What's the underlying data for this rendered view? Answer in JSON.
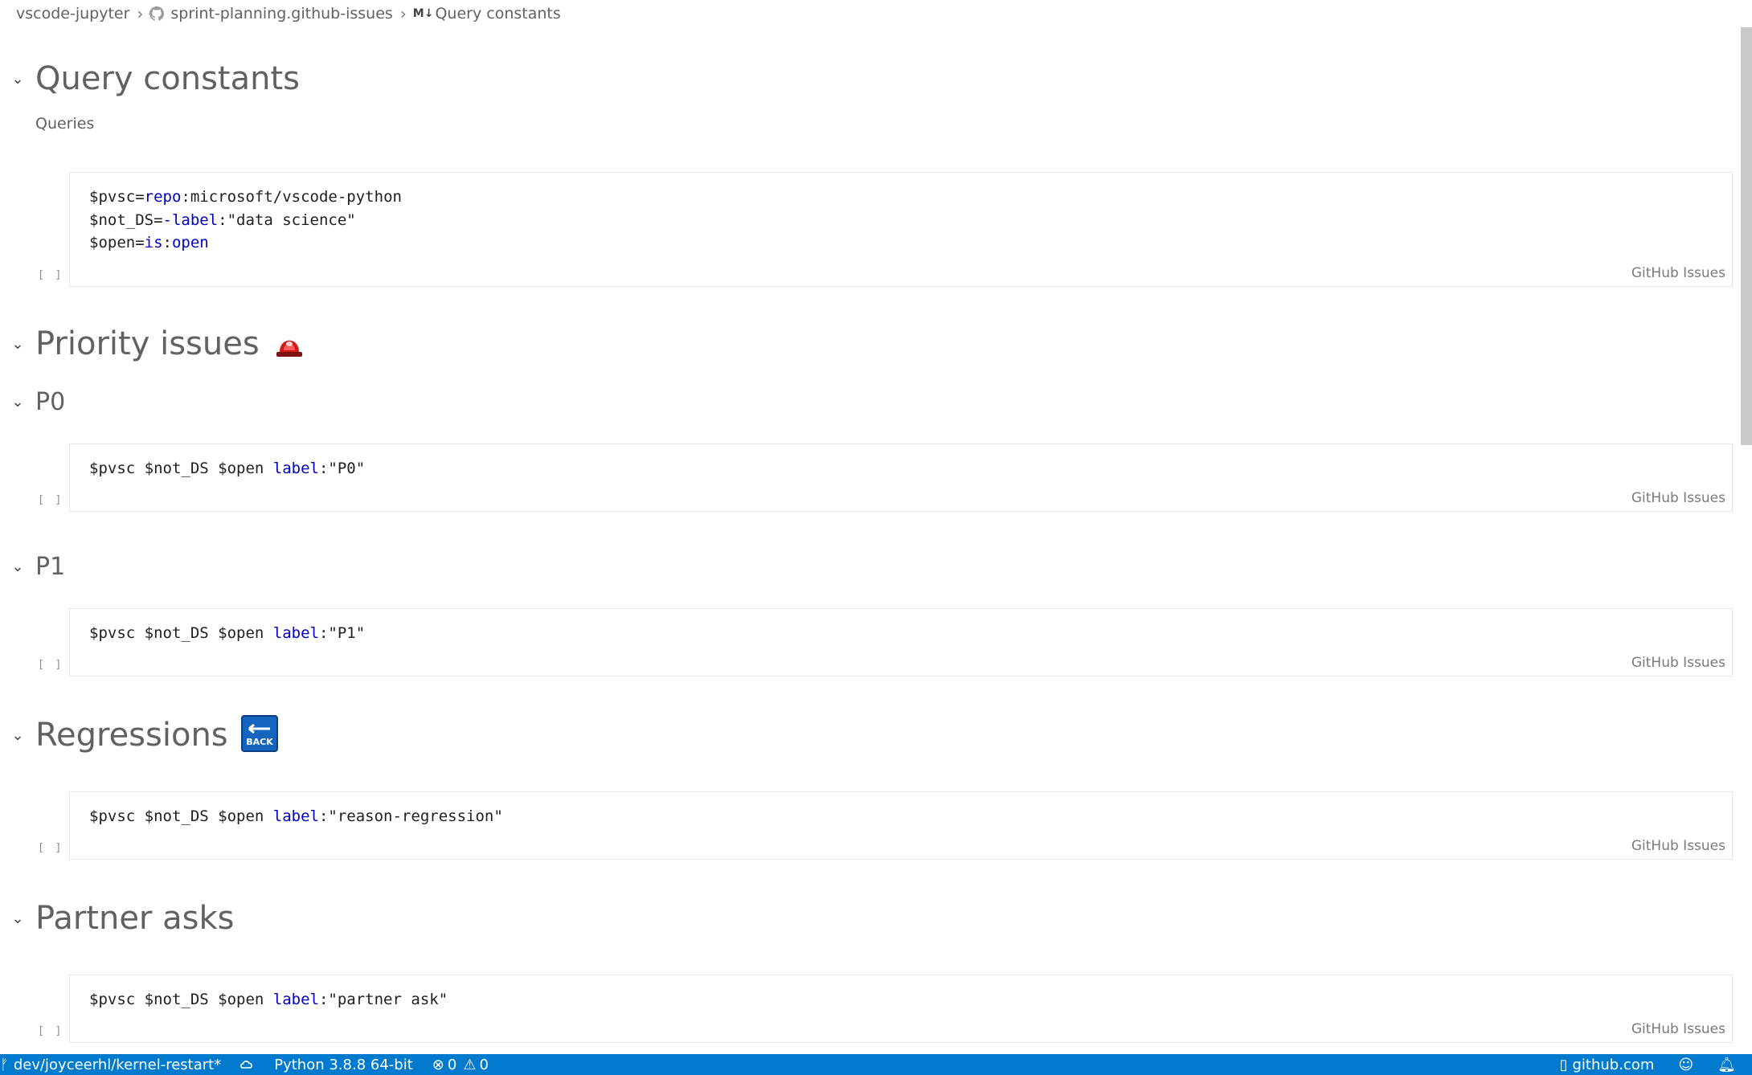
{
  "breadcrumb": {
    "workspace": "vscode-jupyter",
    "file": "sprint-planning.github-issues",
    "md_badge": "M↓",
    "section": "Query constants"
  },
  "sections": {
    "query_constants": {
      "title": "Query constants",
      "subtitle": "Queries"
    },
    "priority": {
      "title": "Priority issues",
      "icon": "red-siren-icon"
    },
    "p0": {
      "title": "P0"
    },
    "p1": {
      "title": "P1"
    },
    "regressions": {
      "title": "Regressions",
      "icon": "back-arrow-icon",
      "icon_text": "BACK"
    },
    "partner": {
      "title": "Partner asks"
    }
  },
  "cells": [
    {
      "exec": "[ ]",
      "lang": "GitHub Issues",
      "lines": [
        [
          {
            "t": "$pvsc="
          },
          {
            "t": "repo",
            "kw": true
          },
          {
            "t": ":microsoft/vscode-python"
          }
        ],
        [
          {
            "t": "$not_DS="
          },
          {
            "t": "-label",
            "kw": true
          },
          {
            "t": ":\"data science\""
          }
        ],
        [
          {
            "t": "$open="
          },
          {
            "t": "is",
            "kw": true
          },
          {
            "t": ":"
          },
          {
            "t": "open",
            "kw": true
          }
        ]
      ]
    },
    {
      "exec": "[ ]",
      "lang": "GitHub Issues",
      "lines": [
        [
          {
            "t": "$pvsc $not_DS $open "
          },
          {
            "t": "label",
            "kw": true
          },
          {
            "t": ":\"P0\""
          }
        ]
      ]
    },
    {
      "exec": "[ ]",
      "lang": "GitHub Issues",
      "lines": [
        [
          {
            "t": "$pvsc $not_DS $open "
          },
          {
            "t": "label",
            "kw": true
          },
          {
            "t": ":\"P1\""
          }
        ]
      ]
    },
    {
      "exec": "[ ]",
      "lang": "GitHub Issues",
      "lines": [
        [
          {
            "t": "$pvsc $not_DS $open "
          },
          {
            "t": "label",
            "kw": true
          },
          {
            "t": ":\"reason-regression\""
          }
        ]
      ]
    },
    {
      "exec": "[ ]",
      "lang": "GitHub Issues",
      "lines": [
        [
          {
            "t": "$pvsc $not_DS $open "
          },
          {
            "t": "label",
            "kw": true
          },
          {
            "t": ":\"partner ask\""
          }
        ]
      ]
    }
  ],
  "statusbar": {
    "branch": "dev/joyceerhl/kernel-restart*",
    "interpreter": "Python 3.8.8 64-bit",
    "errors": "0",
    "warnings": "0",
    "remote": "github.com",
    "accent": "#007acc"
  }
}
